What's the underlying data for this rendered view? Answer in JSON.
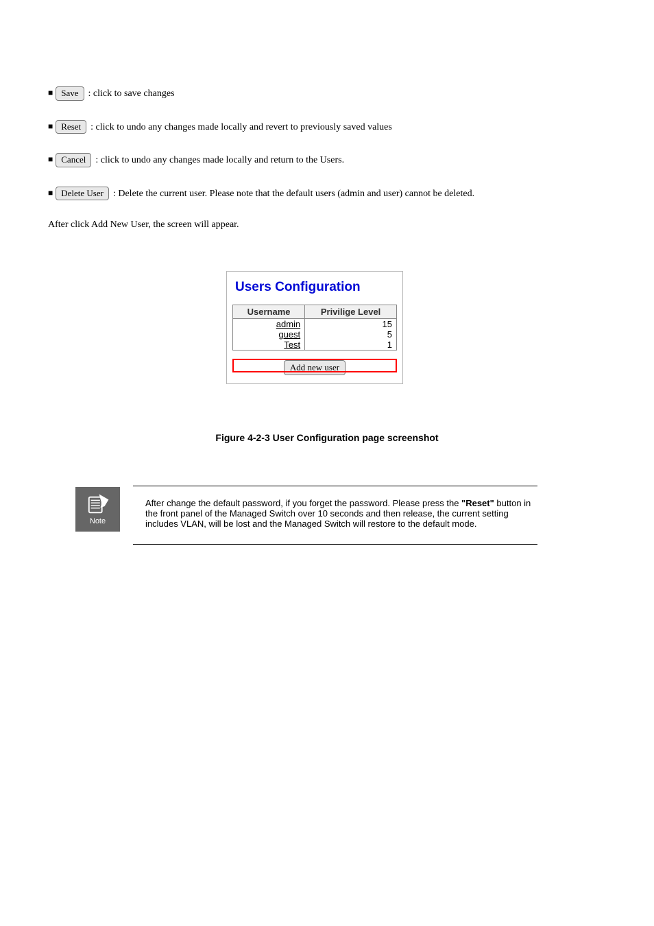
{
  "buttons": {
    "save": {
      "label": "Save",
      "desc": ": click to save changes"
    },
    "reset": {
      "label": "Reset",
      "desc": ": click to undo any changes made locally and revert to previously saved values"
    },
    "cancel": {
      "label": "Cancel",
      "desc": ": click to undo any changes made locally and return to the Users."
    },
    "delete": {
      "label": "Delete User",
      "desc": ": Delete the current user. Please note that the default users (admin and user) cannot be deleted."
    }
  },
  "post_buttons_text": "After click Add New User, the screen will appear.",
  "figure": {
    "title": "Users Configuration",
    "headers": [
      "Username",
      "Privilige Level"
    ],
    "rows": [
      {
        "username": "admin",
        "level": "15"
      },
      {
        "username": "guest",
        "level": "5"
      },
      {
        "username": "Test",
        "level": "1"
      }
    ],
    "add_button": "Add new user",
    "caption": "Figure 4-2-3 User Configuration page screenshot"
  },
  "note": {
    "label": "Note",
    "text_prefix": "After change the default password, if you forget the password. Please press the ",
    "text_strong": "\"Reset\"",
    "text_rest": " button in the front panel of the Managed Switch over 10 seconds and then release, the current setting includes VLAN, will be lost and the Managed Switch will restore to the default mode."
  }
}
